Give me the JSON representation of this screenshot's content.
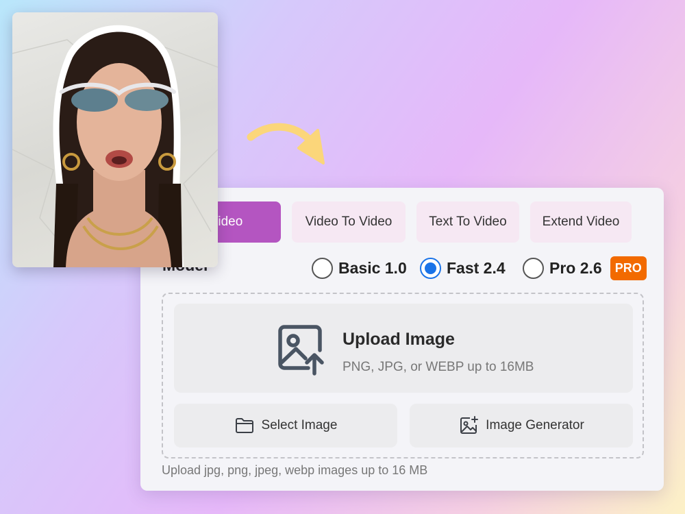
{
  "tabs": [
    {
      "label": "To Video",
      "active": true
    },
    {
      "label": "Video To Video",
      "active": false
    },
    {
      "label": "Text To Video",
      "active": false
    },
    {
      "label": "Extend Video",
      "active": false
    }
  ],
  "model": {
    "label": "Model",
    "options": [
      {
        "label": "Basic 1.0",
        "selected": false
      },
      {
        "label": "Fast 2.4",
        "selected": true
      },
      {
        "label": "Pro 2.6",
        "selected": false,
        "badge": "PRO"
      }
    ]
  },
  "upload": {
    "title": "Upload Image",
    "subtitle": "PNG, JPG, or WEBP up to 16MB",
    "select_button": "Select Image",
    "generator_button": "Image Generator",
    "footnote": "Upload jpg, png, jpeg, webp images up to 16 MB"
  },
  "icons": {
    "upload": "image-upload-icon",
    "select": "folder-icon",
    "generator": "image-sparkle-icon",
    "arrow": "curved-arrow-icon"
  },
  "colors": {
    "accent": "#b455c1",
    "tab_bg": "#f6e8f3",
    "radio_checked": "#1a73e8",
    "pro_badge": "#f26a00",
    "arrow": "#fbd67a"
  }
}
